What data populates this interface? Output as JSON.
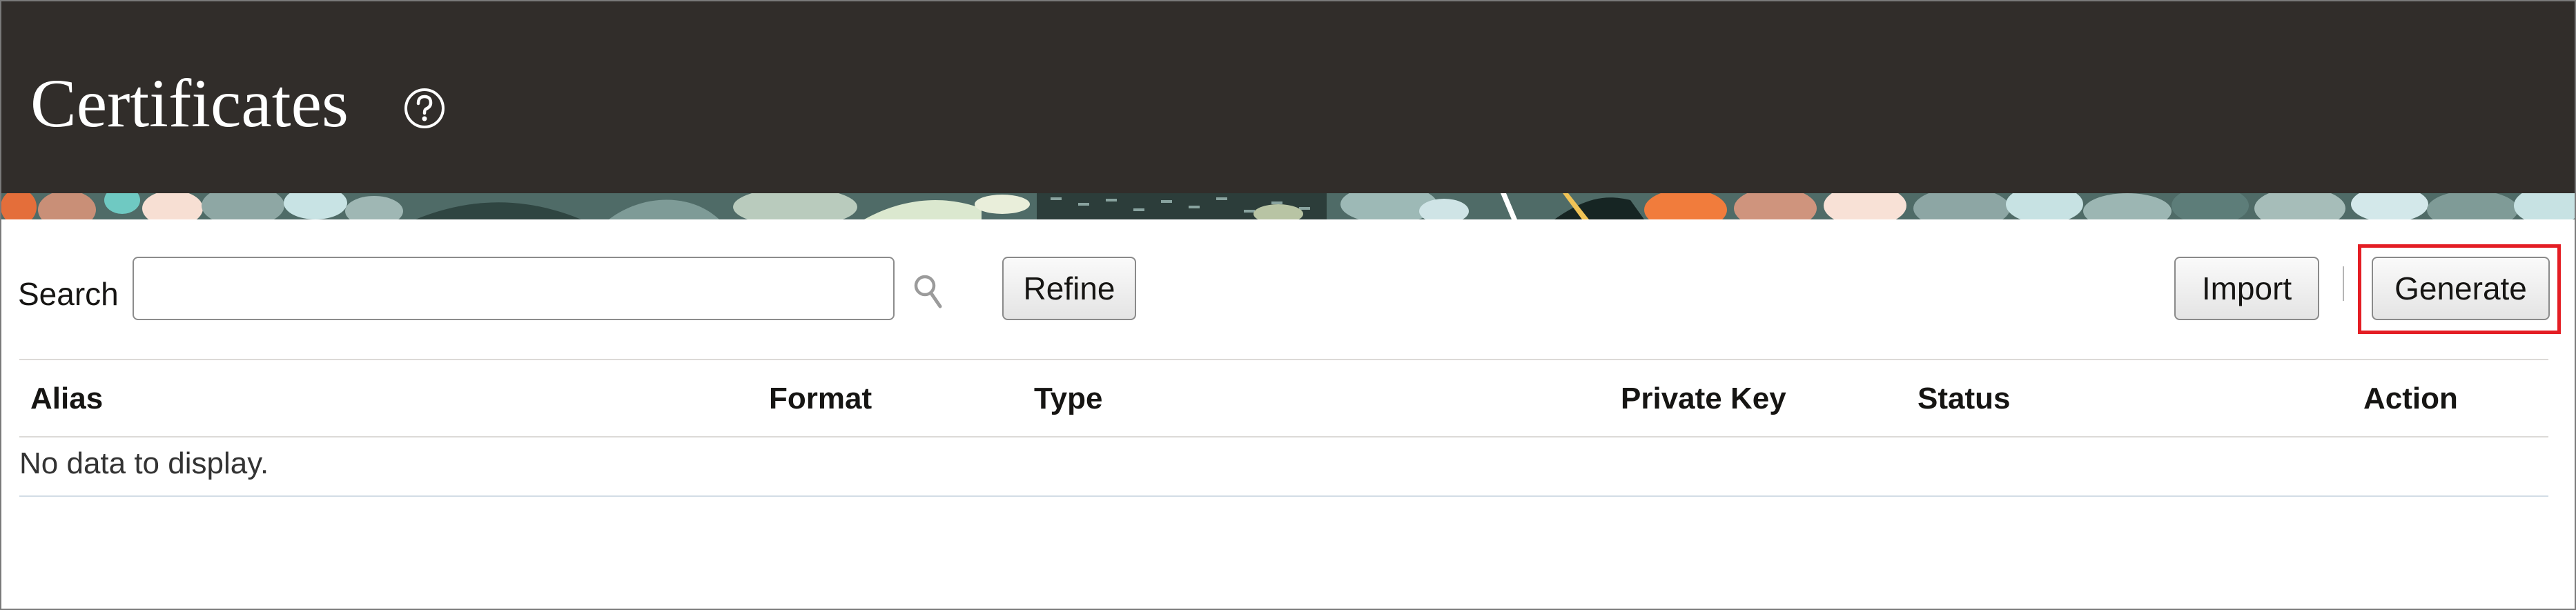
{
  "page": {
    "title": "Certificates",
    "help_icon": "help-circle-icon"
  },
  "toolbar": {
    "search_label": "Search",
    "search_value": "",
    "search_icon": "magnifier-icon",
    "refine_label": "Refine",
    "import_label": "Import",
    "generate_label": "Generate"
  },
  "table": {
    "columns": [
      "Alias",
      "Format",
      "Type",
      "Private Key",
      "Status",
      "Action"
    ],
    "rows": [],
    "empty_message": "No data to display."
  },
  "colors": {
    "header_bg": "#312d2a",
    "highlight": "#e41d24"
  }
}
